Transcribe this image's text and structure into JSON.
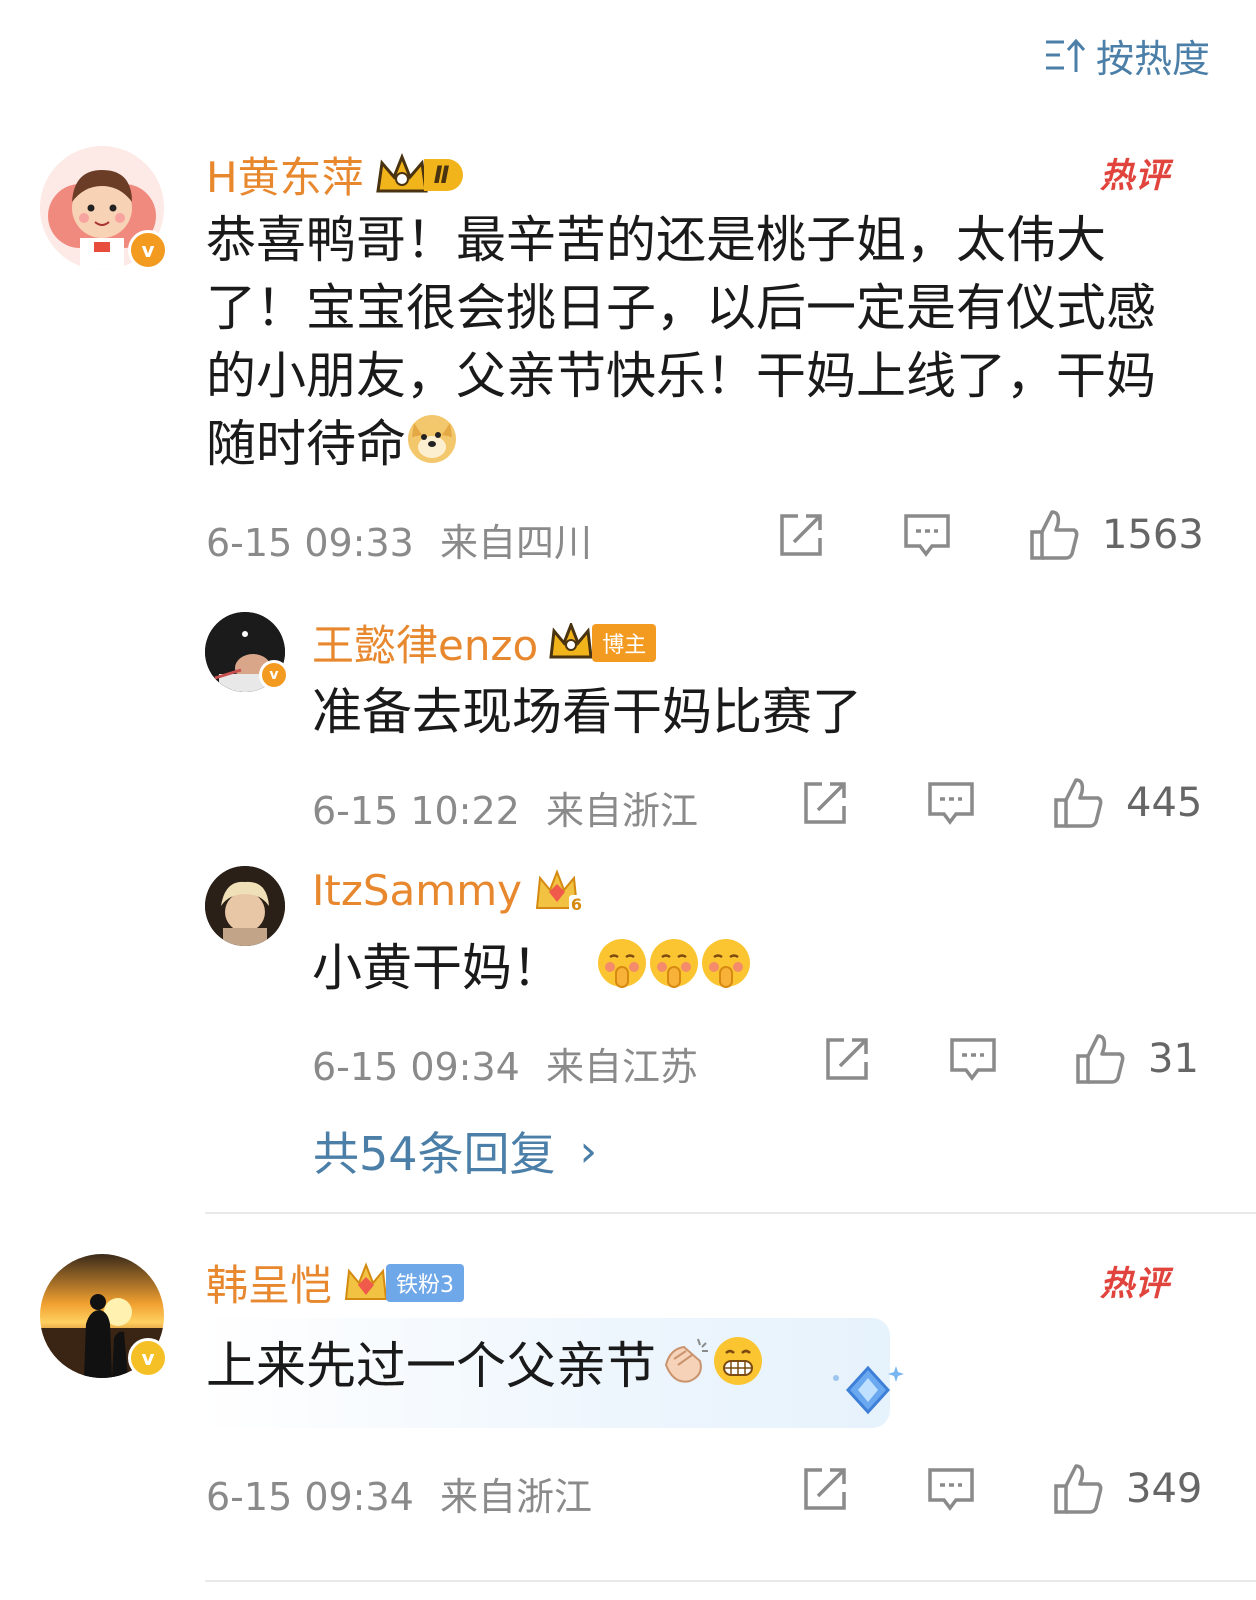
{
  "sort": {
    "label": "按热度",
    "icon": "sort-icon"
  },
  "colors": {
    "username": "#e8882e",
    "link": "#4b7fa8",
    "hot": "#e0443c",
    "meta": "#8a8a8a"
  },
  "comments": [
    {
      "user": "H黄东萍",
      "badge_text": "Ⅱ",
      "hot_tag": "热评",
      "text": "恭喜鸭哥！最辛苦的还是桃子姐，太伟大了！宝宝很会挑日子，以后一定是有仪式感的小朋友，父亲节快乐！干妈上线了，干妈随时待命",
      "time": "6-15 09:33",
      "location": "来自四川",
      "likes": "1563",
      "emoji_icon": "doge-emoji-icon",
      "verified_icon": "verified-v-icon"
    },
    {
      "user": "韩呈恺",
      "badge_text": "铁粉3",
      "hot_tag": "热评",
      "text": "上来先过一个父亲节",
      "time": "6-15 09:34",
      "location": "来自浙江",
      "likes": "349",
      "emoji_icons": [
        "clap-emoji-icon",
        "grin-emoji-icon"
      ],
      "verified_icon": "verified-v-icon"
    }
  ],
  "replies": [
    {
      "user": "王懿律enzo",
      "badge_text": "博主",
      "text": "准备去现场看干妈比赛了",
      "time": "6-15 10:22",
      "location": "来自浙江",
      "likes": "445"
    },
    {
      "user": "ItzSammy",
      "badge_text": "6",
      "text": "小黄干妈！",
      "time": "6-15 09:34",
      "location": "来自江苏",
      "likes": "31",
      "emoji_icons": [
        "shush-emoji-icon",
        "shush-emoji-icon",
        "shush-emoji-icon"
      ]
    }
  ],
  "more_replies": {
    "label": "共54条回复",
    "chevron": "›"
  }
}
